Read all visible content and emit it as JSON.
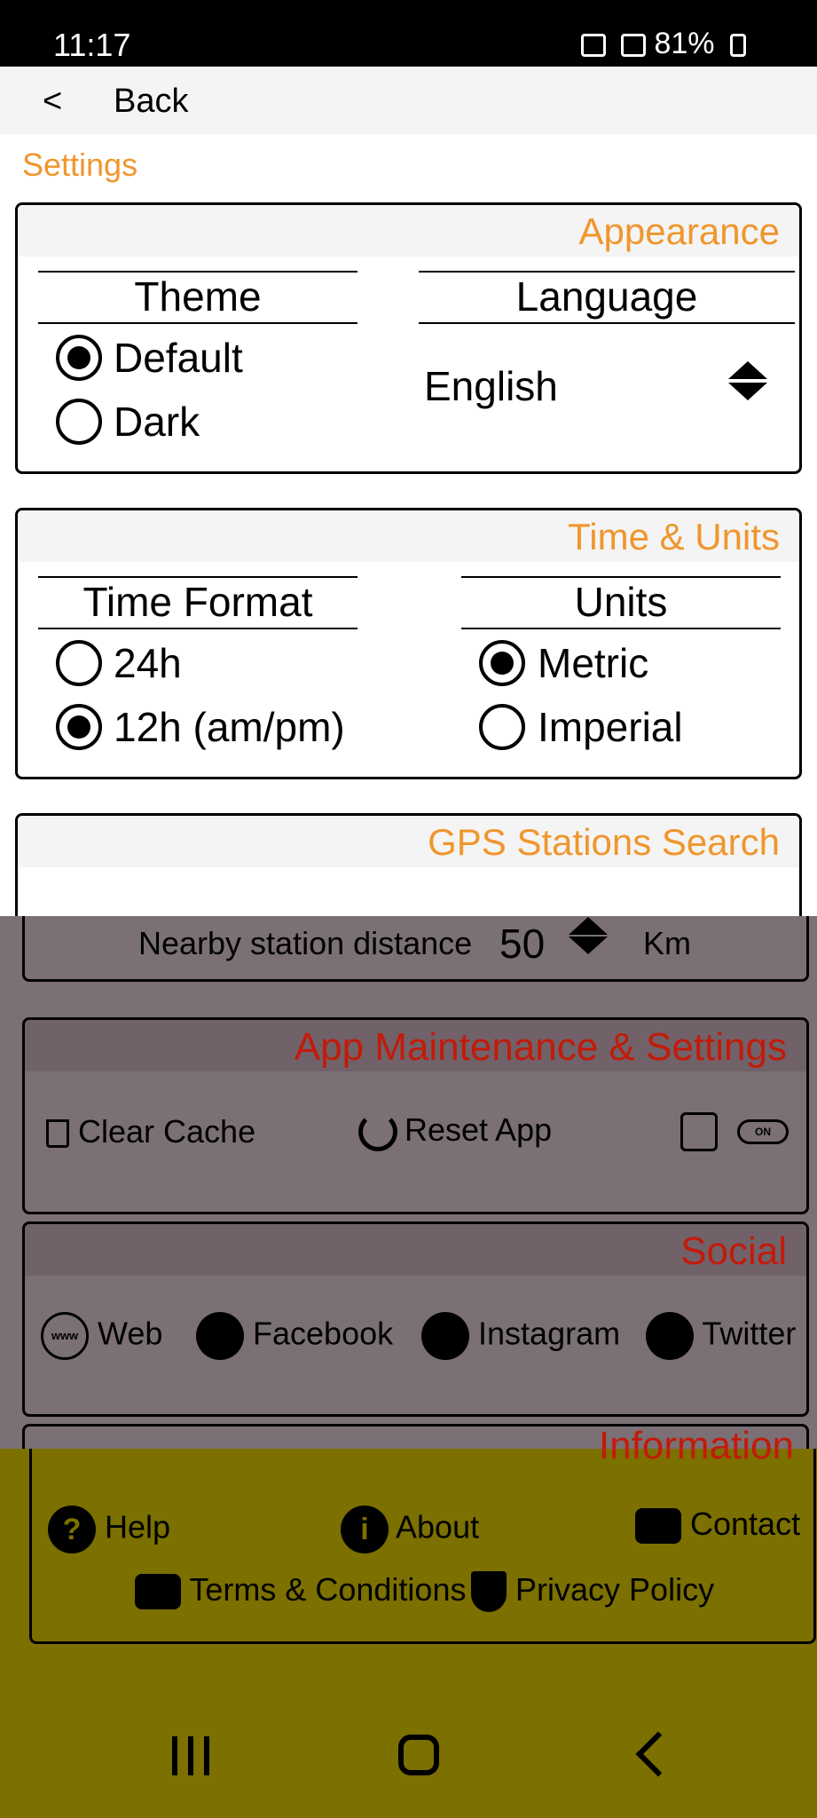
{
  "status_bar": {
    "time": "11:17",
    "battery": "81%"
  },
  "top_bar": {
    "back_icon": "<",
    "back_label": "Back"
  },
  "page_title": "Settings",
  "appearance": {
    "title": "Appearance",
    "theme": {
      "header": "Theme",
      "options": [
        "Default",
        "Dark"
      ],
      "selected": "Default"
    },
    "language": {
      "header": "Language",
      "value": "English"
    }
  },
  "time_units": {
    "title": "Time & Units",
    "time_format": {
      "header": "Time Format",
      "options": [
        "24h",
        "12h (am/pm)"
      ],
      "selected": "12h (am/pm)"
    },
    "units": {
      "header": "Units",
      "options": [
        "Metric",
        "Imperial"
      ],
      "selected": "Metric"
    }
  },
  "gps": {
    "title": "GPS Stations Search",
    "distance_label": "Nearby station distance",
    "distance_value": "50",
    "distance_unit": "Km"
  },
  "maintenance": {
    "title": "App Maintenance & Settings",
    "clear_cache": "Clear Cache",
    "reset_app": "Reset App",
    "toggle_text": "ON"
  },
  "social": {
    "title": "Social",
    "web": "Web",
    "web_icon_text": "www",
    "facebook": "Facebook",
    "instagram": "Instagram",
    "twitter": "Twitter"
  },
  "information": {
    "title": "Information",
    "help": "Help",
    "about": "About",
    "contact": "Contact",
    "terms": "Terms & Conditions",
    "privacy": "Privacy Policy"
  },
  "icons": {
    "help": "?",
    "about": "i"
  },
  "colors": {
    "accent": "#f0962d",
    "dim_title": "#c31a0a",
    "overlay_dim": "#7a7075",
    "overlay_yellow": "#7b7000"
  }
}
